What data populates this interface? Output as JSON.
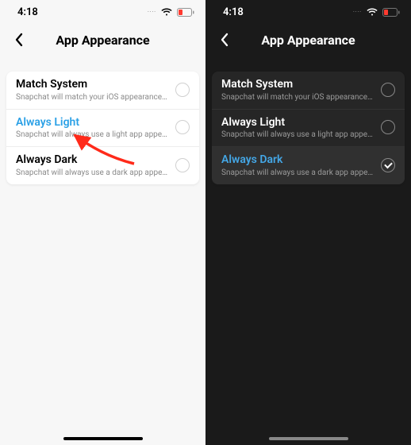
{
  "status": {
    "time": "4:18",
    "cellular_dots": "····"
  },
  "header": {
    "title": "App Appearance"
  },
  "light_panel": {
    "options": [
      {
        "title": "Match System",
        "subtitle": "Snapchat will match your iOS appearance setti…",
        "selected": false
      },
      {
        "title": "Always Light",
        "subtitle": "Snapchat will always use a light app appearance.",
        "selected": true
      },
      {
        "title": "Always Dark",
        "subtitle": "Snapchat will always use a dark app appearance.",
        "selected": false
      }
    ]
  },
  "dark_panel": {
    "options": [
      {
        "title": "Match System",
        "subtitle": "Snapchat will match your iOS appearance setti…",
        "selected": false
      },
      {
        "title": "Always Light",
        "subtitle": "Snapchat will always use a light app appearance.",
        "selected": false
      },
      {
        "title": "Always Dark",
        "subtitle": "Snapchat will always use a dark app appearance.",
        "selected": true
      }
    ]
  },
  "colors": {
    "accent": "#2aa0e6",
    "arrow": "#ff2a1a"
  }
}
